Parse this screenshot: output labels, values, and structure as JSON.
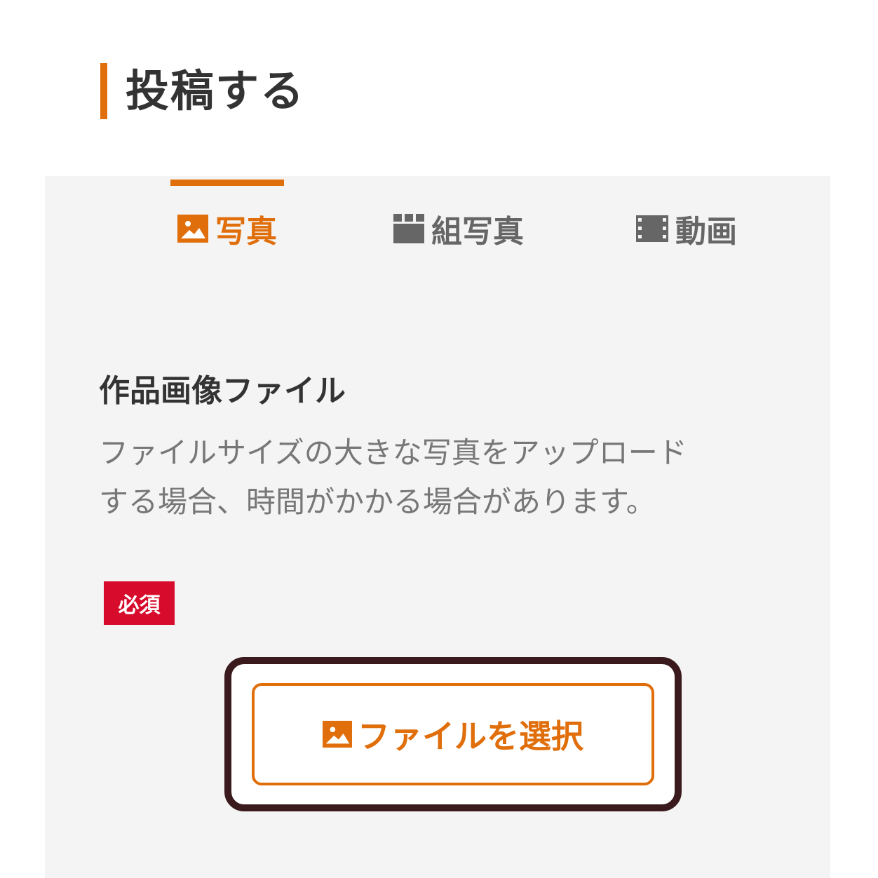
{
  "header": {
    "title": "投稿する",
    "accent_color": "#e06e0a"
  },
  "tabs": [
    {
      "label": "写真",
      "icon": "image-icon",
      "active": true
    },
    {
      "label": "組写真",
      "icon": "grid-icon",
      "active": false
    },
    {
      "label": "動画",
      "icon": "film-icon",
      "active": false
    }
  ],
  "form": {
    "field_title": "作品画像ファイル",
    "description_line1": "ファイルサイズの大きな写真をアップロード",
    "description_line2": "する場合、時間がかかる場合があります。",
    "required_label": "必須",
    "required_color": "#d70c2c",
    "select_button_label": "ファイルを選択",
    "select_button_icon": "image-icon"
  }
}
